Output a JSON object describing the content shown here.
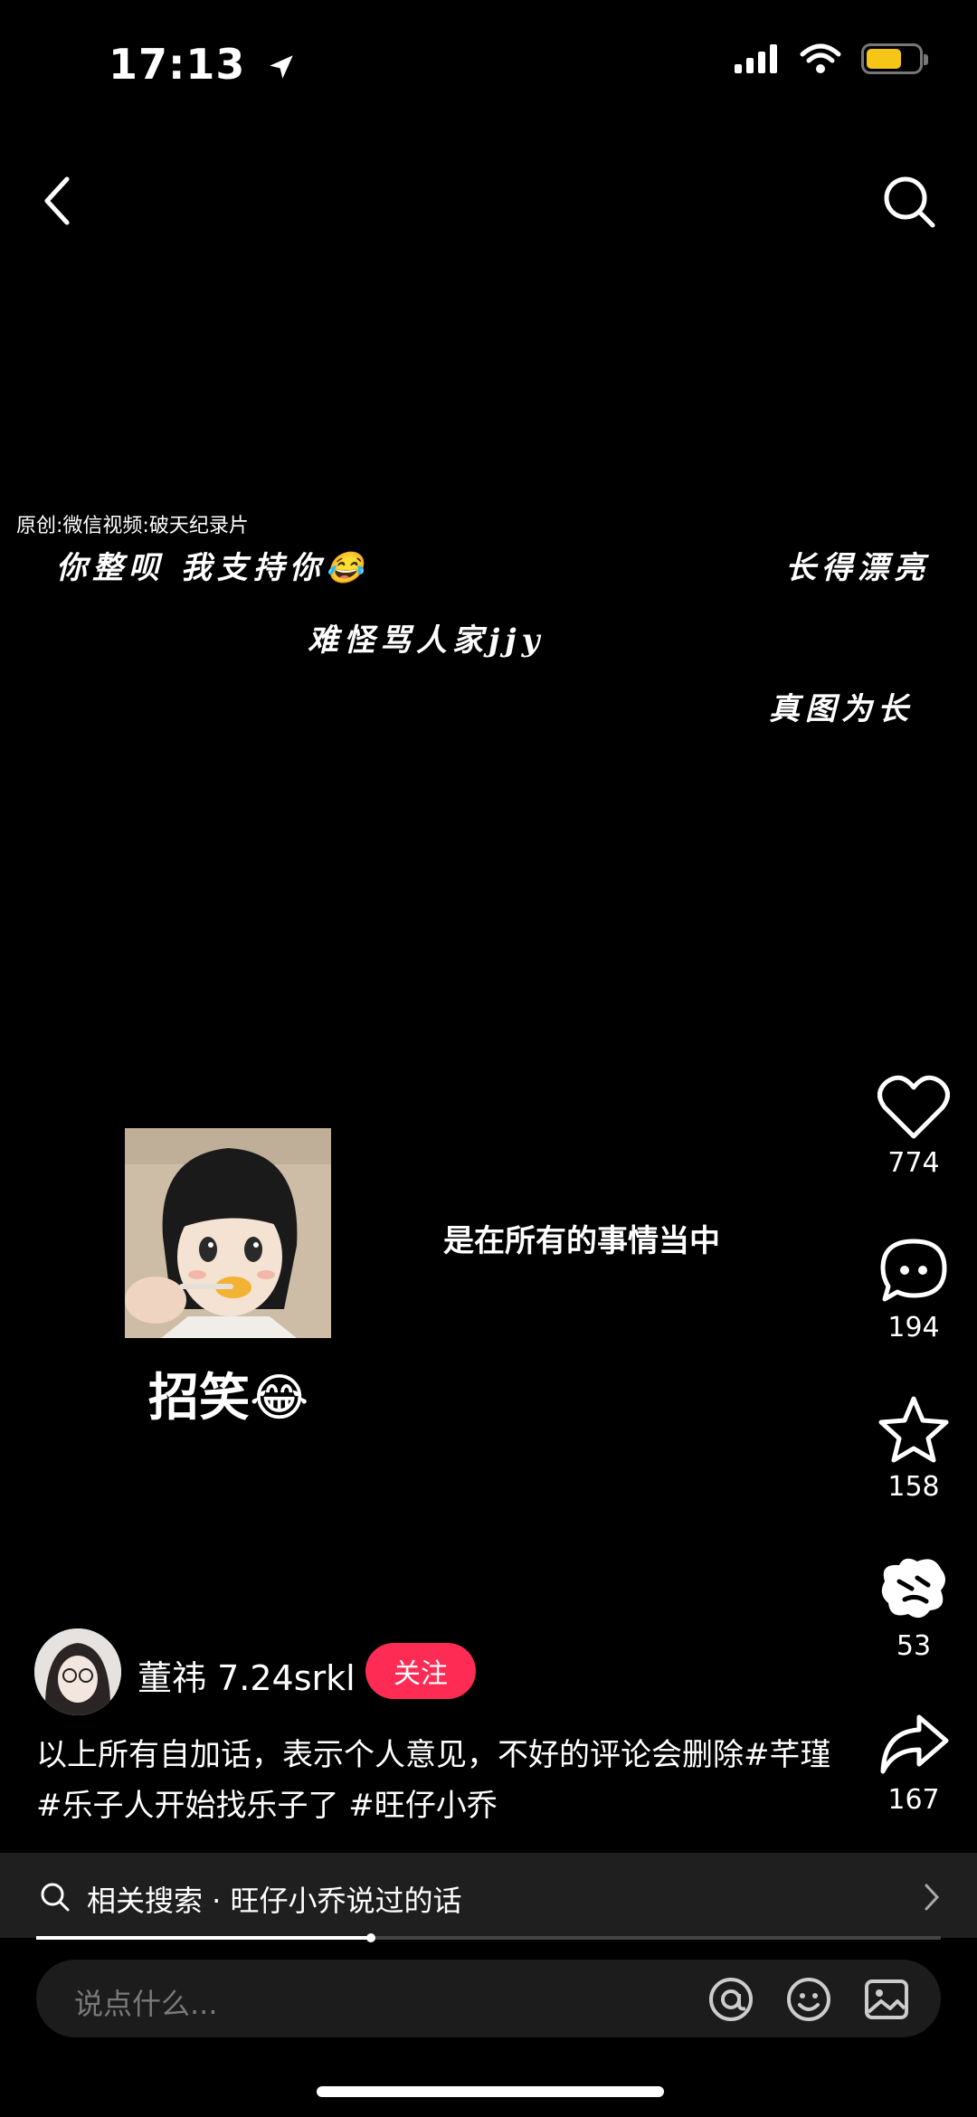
{
  "status": {
    "time": "17:13",
    "battery_color": "#f5c518"
  },
  "nav": {
    "back_icon": "chevron-left-icon",
    "search_icon": "search-icon"
  },
  "video": {
    "source_label": "原创:微信视频:破天纪录片",
    "overlay_line1": "你整呗 我支持你😂",
    "overlay_line2": "难怪骂人家jjy",
    "overlay_right1": "长得漂亮",
    "overlay_right2": "真图为长",
    "caption": "是在所有的事情当中",
    "sticker_caption": "招笑😂"
  },
  "actions": {
    "likes": "774",
    "comments": "194",
    "favorites": "158",
    "shares_icon_count": "53",
    "forwards": "167"
  },
  "author": {
    "name": "董祎 7.24srkl",
    "follow_label": "关注"
  },
  "description": "以上所有自加话，表示个人意见，不好的评论会删除#芊瑾 #乐子人开始找乐子了 #旺仔小乔",
  "related_search": {
    "text": "相关搜索 · 旺仔小乔说过的话"
  },
  "progress": {
    "fraction": 0.37
  },
  "comment": {
    "placeholder": "说点什么..."
  },
  "colors": {
    "accent": "#fe2c55"
  }
}
